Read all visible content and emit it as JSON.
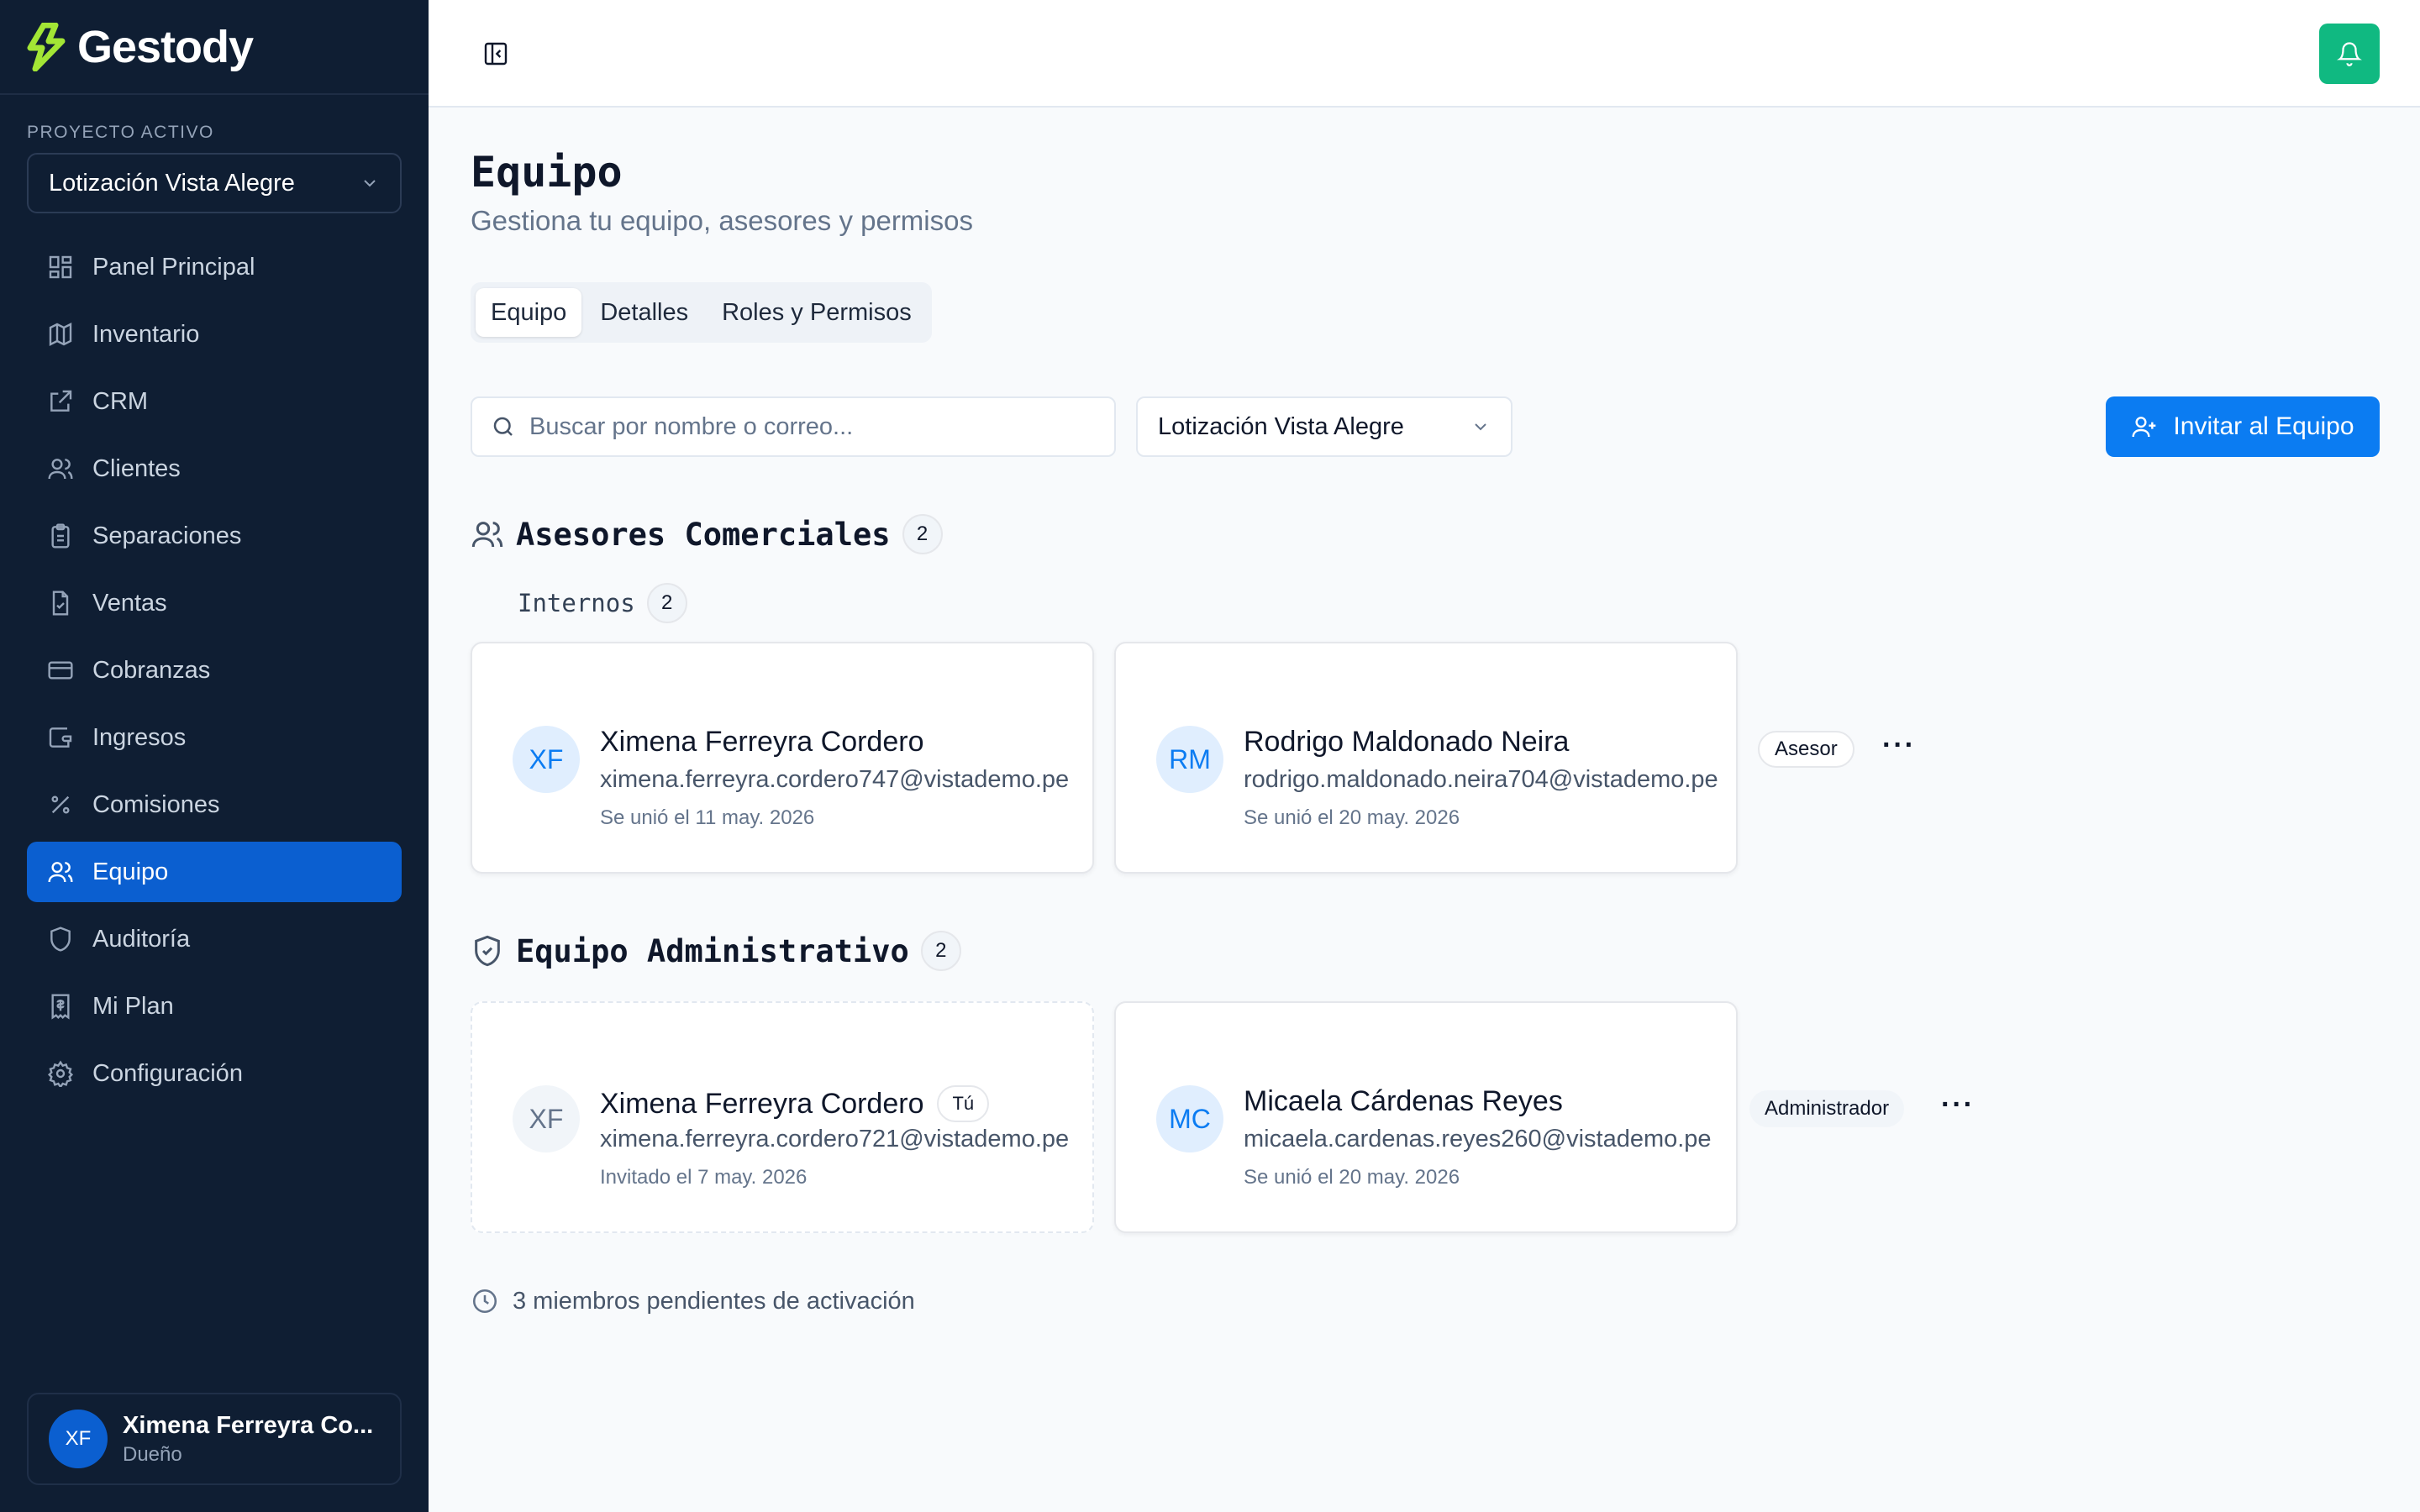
{
  "brand": {
    "name": "Gestody",
    "accent": "#a3e635",
    "primary": "#0b7cf2",
    "sidebar_bg": "#0f1e33"
  },
  "sidebar": {
    "project_label": "PROYECTO ACTIVO",
    "project_value": "Lotización Vista Alegre",
    "items": [
      {
        "label": "Panel Principal",
        "icon": "dashboard-icon"
      },
      {
        "label": "Inventario",
        "icon": "map-icon"
      },
      {
        "label": "CRM",
        "icon": "external-link-icon"
      },
      {
        "label": "Clientes",
        "icon": "users-icon"
      },
      {
        "label": "Separaciones",
        "icon": "clipboard-icon"
      },
      {
        "label": "Ventas",
        "icon": "file-check-icon"
      },
      {
        "label": "Cobranzas",
        "icon": "credit-card-icon"
      },
      {
        "label": "Ingresos",
        "icon": "wallet-icon"
      },
      {
        "label": "Comisiones",
        "icon": "percent-icon"
      },
      {
        "label": "Equipo",
        "icon": "team-icon",
        "active": true
      },
      {
        "label": "Auditoría",
        "icon": "shield-icon"
      },
      {
        "label": "Mi Plan",
        "icon": "receipt-icon"
      },
      {
        "label": "Configuración",
        "icon": "gear-icon"
      }
    ],
    "user": {
      "initials": "XF",
      "name": "Ximena Ferreyra Co...",
      "role": "Dueño"
    }
  },
  "header": {
    "title": "Equipo",
    "subtitle": "Gestiona tu equipo, asesores y permisos"
  },
  "tabs": [
    "Equipo",
    "Detalles",
    "Roles y Permisos"
  ],
  "toolbar": {
    "search_placeholder": "Buscar por nombre o correo...",
    "project_filter": "Lotización Vista Alegre",
    "invite_label": "Invitar al Equipo"
  },
  "sections": {
    "asesores": {
      "title": "Asesores Comerciales",
      "count": "2",
      "subgroup": {
        "title": "Internos",
        "count": "2"
      },
      "members": [
        {
          "initials": "XF",
          "name": "Ximena Ferreyra Cordero",
          "email": "ximena.ferreyra.cordero747@vistademo.pe",
          "date": "Se unió el 11 may. 2026"
        },
        {
          "initials": "RM",
          "name": "Rodrigo Maldonado Neira",
          "email": "rodrigo.maldonado.neira704@vistademo.pe",
          "date": "Se unió el 20 may. 2026",
          "role": "Asesor"
        }
      ]
    },
    "admin": {
      "title": "Equipo Administrativo",
      "count": "2",
      "members": [
        {
          "initials": "XF",
          "name": "Ximena Ferreyra Cordero",
          "badge": "Tú",
          "email": "ximena.ferreyra.cordero721@vistademo.pe",
          "date": "Invitado el 7 may. 2026"
        },
        {
          "initials": "MC",
          "name": "Micaela Cárdenas Reyes",
          "email": "micaela.cardenas.reyes260@vistademo.pe",
          "date": "Se unió el 20 may. 2026",
          "role": "Administrador"
        }
      ]
    }
  },
  "more_label": "···",
  "pending_text": "3 miembros pendientes de activación"
}
